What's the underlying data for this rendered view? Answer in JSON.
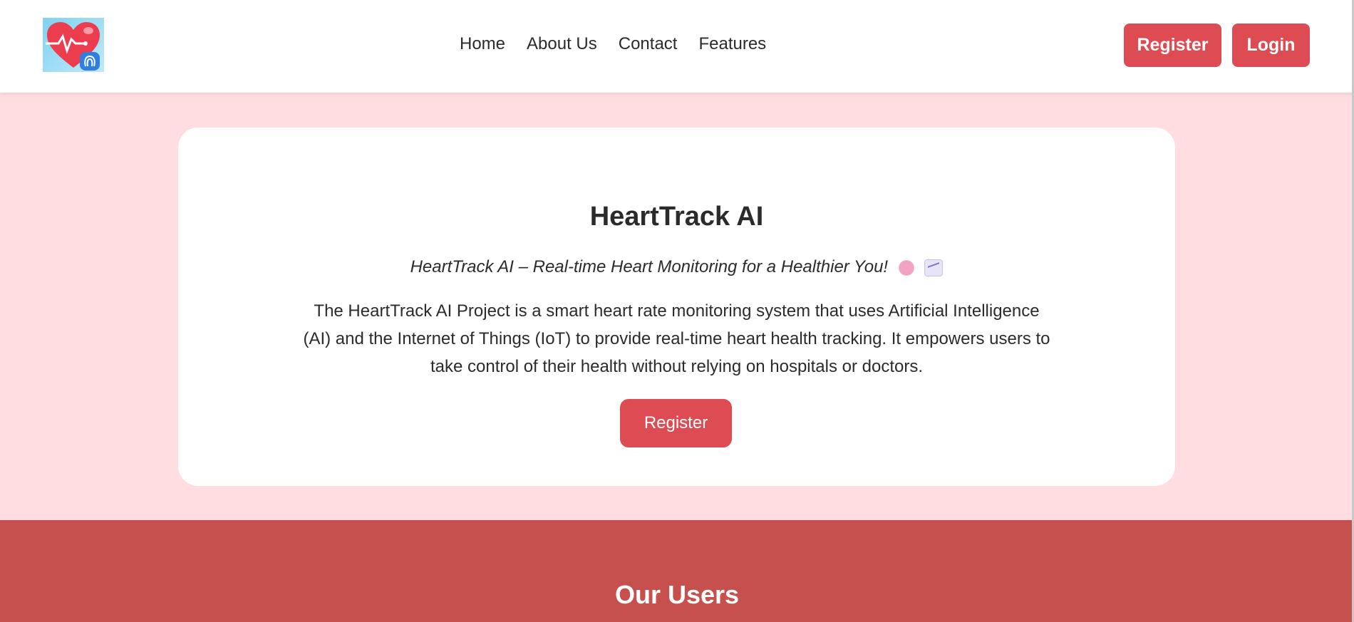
{
  "brand": {
    "logo": "heart-pulse-logo"
  },
  "nav": {
    "links": [
      {
        "label": "Home"
      },
      {
        "label": "About Us"
      },
      {
        "label": "Contact"
      },
      {
        "label": "Features"
      }
    ],
    "register_label": "Register",
    "login_label": "Login"
  },
  "hero": {
    "title": "HeartTrack AI",
    "tagline": "HeartTrack AI – Real-time Heart Monitoring for a Healthier You!",
    "tagline_emojis": [
      "brain-emoji",
      "chart-increasing-emoji"
    ],
    "description": "The HeartTrack AI Project is a smart heart rate monitoring system that uses Artificial Intelligence (AI) and the Internet of Things (IoT) to provide real-time heart health tracking. It empowers users to take control of their health without relying on hospitals or doctors.",
    "cta_label": "Register"
  },
  "users_section": {
    "title": "Our Users"
  },
  "colors": {
    "accent": "#dc4c52",
    "page_background": "#ffdde0",
    "users_background": "#c6504e",
    "text": "#2b2b2b"
  }
}
